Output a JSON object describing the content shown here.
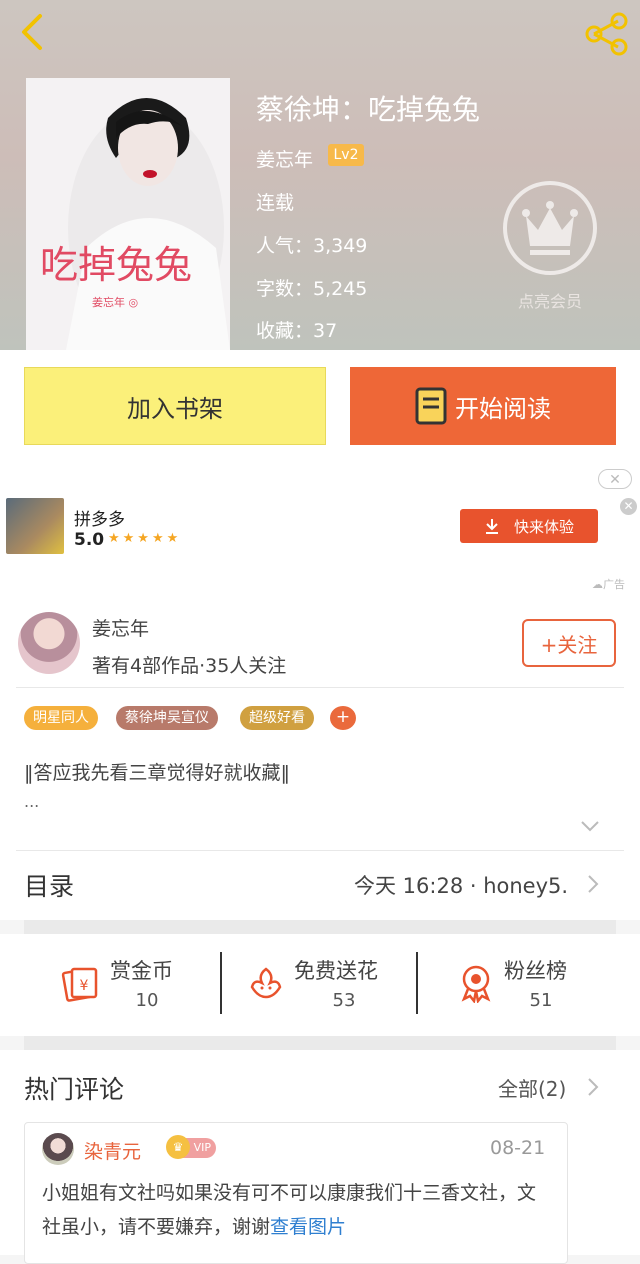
{
  "book": {
    "title": "蔡徐坤：吃掉兔兔",
    "author": "姜忘年",
    "level": "Lv2",
    "status": "连载",
    "popularity": "人气：3,349",
    "word_count": "字数：5,245",
    "favorites": "收藏：37",
    "cover_title": "吃掉兔兔"
  },
  "vip": {
    "label": "点亮会员"
  },
  "actions": {
    "add_shelf": "加入书架",
    "start_read": "开始阅读"
  },
  "ad": {
    "name": "拼多多",
    "score": "5.0",
    "stars": "★★★★★",
    "cta": "快来体验",
    "tag": "广告"
  },
  "author": {
    "name": "姜忘年",
    "stats": "著有4部作品·35人关注",
    "follow": "+关注",
    "tags": [
      "明星同人",
      "蔡徐坤吴宣仪",
      "超级好看"
    ],
    "tag_colors": [
      "#f5b03c",
      "#b87a6a",
      "#d0a040"
    ],
    "add_tag": "+"
  },
  "intro": {
    "text": "‖答应我先看三章觉得好就收藏‖",
    "more": "..."
  },
  "toc": {
    "title": "目录",
    "latest": "今天 16:28 · honey5."
  },
  "stats": [
    {
      "label": "赏金币",
      "value": "10",
      "icon": "coin-envelope-icon"
    },
    {
      "label": "免费送花",
      "value": "53",
      "icon": "flower-icon"
    },
    {
      "label": "粉丝榜",
      "value": "51",
      "icon": "medal-icon"
    }
  ],
  "comments": {
    "title": "热门评论",
    "all": "全部(2)",
    "items": [
      {
        "user": "染青元",
        "badge": "VIP",
        "date": "08-21",
        "text": "小姐姐有文社吗如果没有可不可以康康我们十三香文社，文社虽小，请不要嫌弃，谢谢",
        "link": "查看图片"
      }
    ]
  },
  "colors": {
    "accent": "#ee6737",
    "shelf": "#fbf07a",
    "link": "#2f7fd0"
  }
}
